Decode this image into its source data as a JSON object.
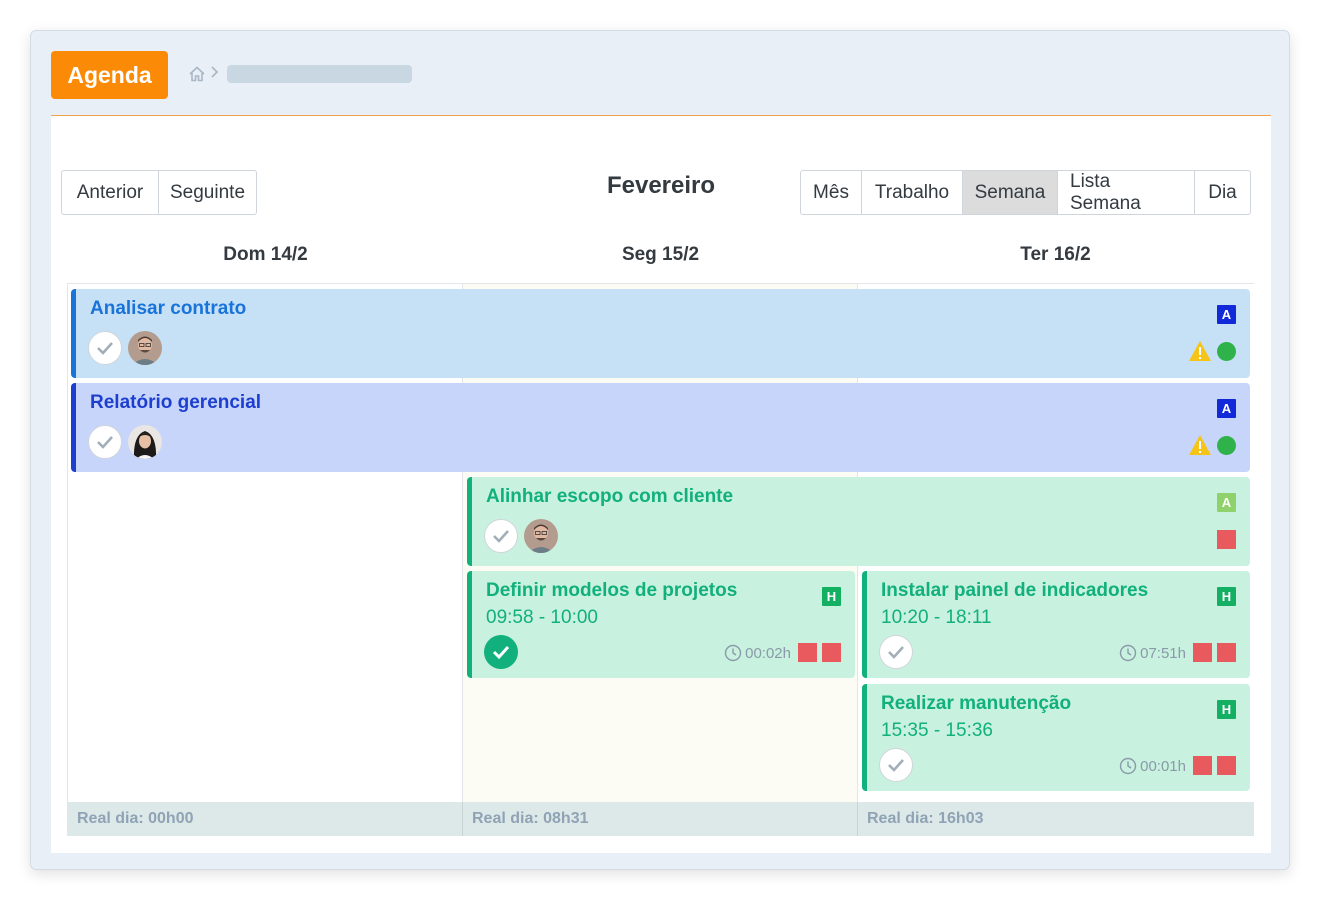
{
  "app": {
    "title": "Agenda"
  },
  "toolbar": {
    "prev_label": "Anterior",
    "next_label": "Seguinte",
    "month_title": "Fevereiro",
    "views": [
      "Mês",
      "Trabalho",
      "Semana",
      "Lista Semana",
      "Dia"
    ],
    "active_view": "Semana"
  },
  "days": [
    {
      "header": "Dom 14/2",
      "footer": "Real dia: 00h00"
    },
    {
      "header": "Seg 15/2",
      "footer": "Real dia: 08h31"
    },
    {
      "header": "Ter 16/2",
      "footer": "Real dia: 16h03"
    }
  ],
  "events": {
    "analisar": {
      "title": "Analisar contrato",
      "tag": "A",
      "completed": false,
      "status_icons": [
        "warning-icon",
        "green-dot-icon"
      ]
    },
    "relatorio": {
      "title": "Relatório gerencial",
      "tag": "A",
      "completed": false,
      "status_icons": [
        "warning-icon",
        "green-dot-icon"
      ]
    },
    "alinhar": {
      "title": "Alinhar escopo com cliente",
      "tag": "A",
      "completed": false
    },
    "definir": {
      "title": "Definir modelos de projetos",
      "time": "09:58 - 10:00",
      "tag": "H",
      "completed": true,
      "duration": "00:02h"
    },
    "instalar": {
      "title": "Instalar painel de indicadores",
      "time": "10:20 - 18:11",
      "tag": "H",
      "completed": false,
      "duration": "07:51h"
    },
    "realizar": {
      "title": "Realizar manutenção",
      "time": "15:35 - 15:36",
      "tag": "H",
      "completed": false,
      "duration": "00:01h"
    }
  },
  "colors": {
    "brand": "#fb8b06",
    "blue_event": "#1a73d9",
    "indigo_event": "#1d3fd0",
    "green_event": "#11b07c",
    "tag_blue": "#1129d8",
    "tag_green_light": "#8fd16b",
    "tag_green": "#13b064",
    "red_square": "#e85a5e"
  }
}
